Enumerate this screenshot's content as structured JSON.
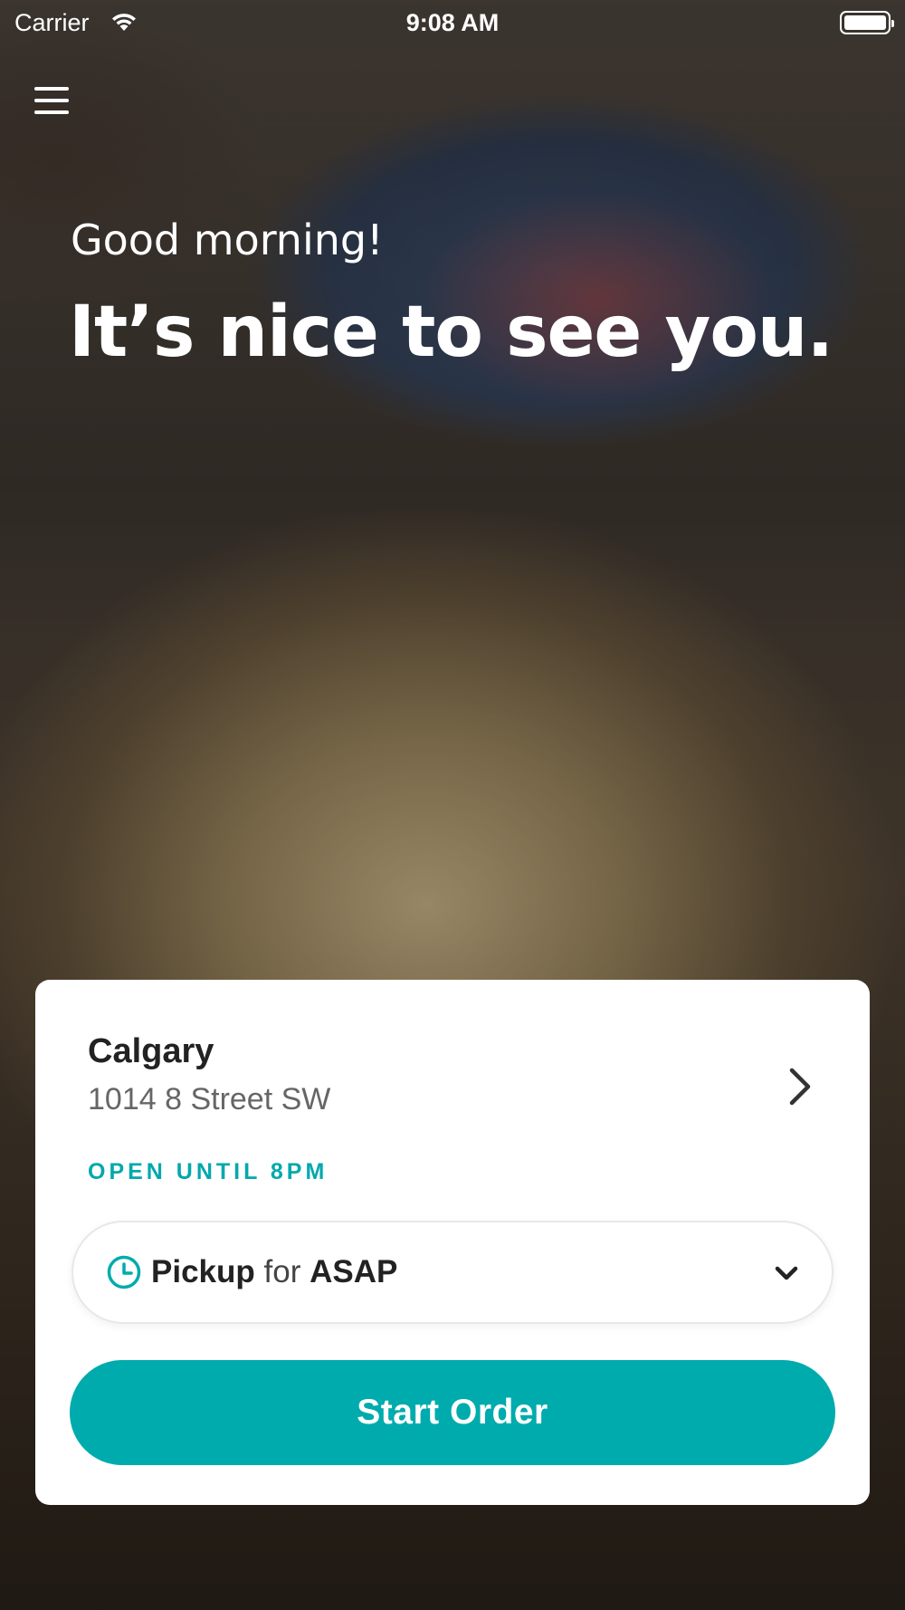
{
  "status_bar": {
    "carrier": "Carrier",
    "time": "9:08 AM",
    "wifi_icon": "wifi-icon",
    "battery_icon": "battery-icon"
  },
  "header": {
    "menu_icon": "hamburger-menu-icon"
  },
  "hero": {
    "greeting": "Good morning!",
    "headline": "It’s nice to see you."
  },
  "location_card": {
    "city": "Calgary",
    "address": "1014 8 Street SW",
    "hours_status": "OPEN UNTIL 8PM",
    "chevron_icon": "chevron-right-icon",
    "order_mode": {
      "method": "Pickup",
      "connector": "for",
      "time": "ASAP",
      "clock_icon": "clock-icon",
      "dropdown_icon": "chevron-down-icon"
    },
    "start_button_label": "Start Order"
  },
  "colors": {
    "accent": "#00abad",
    "hours_text": "#00a8ae",
    "card_bg": "#ffffff",
    "text_primary": "#222222",
    "text_secondary": "#666666"
  }
}
